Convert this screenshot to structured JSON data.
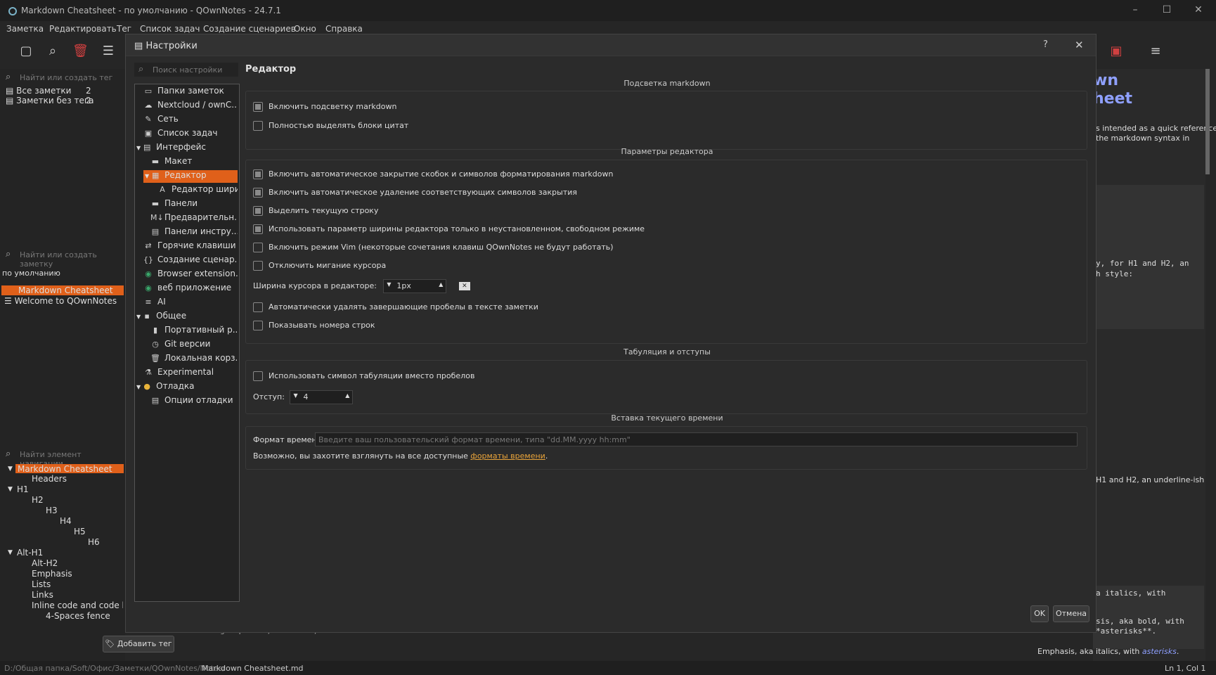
{
  "window": {
    "title": "Markdown Cheatsheet - по умолчанию - QOwnNotes - 24.7.1"
  },
  "menu": [
    "Заметка",
    "Редактировать",
    "Тег",
    "Список задач",
    "Создание сценариев",
    "Окно",
    "Справка"
  ],
  "left": {
    "tag_search": "Найти или создать тег",
    "tags": [
      {
        "label": "Все заметки",
        "count": "2"
      },
      {
        "label": "Заметки без тега",
        "count": "2"
      }
    ],
    "note_search": "Найти или создать заметку",
    "folder": "по умолчанию",
    "notes": [
      "Markdown Cheatsheet",
      "Welcome to QOwnNotes"
    ],
    "nav_search": "Найти элемент навигации",
    "nav": [
      "Markdown Cheatsheet",
      "Headers",
      "H1",
      "H2",
      "H3",
      "H4",
      "H5",
      "H6",
      "Alt-H1",
      "Alt-H2",
      "Emphasis",
      "Lists",
      "Links",
      "Inline code and code bloc",
      "4-Spaces fence"
    ],
    "add_tag": "Добавить тег"
  },
  "right": {
    "heading1": "wn",
    "heading2": "heet",
    "desc1": "s intended as a quick reference",
    "desc2": " the markdown syntax in",
    "code1": "y, for H1 and H2, an",
    "code2": "h style:",
    "h1h2": "H1 and H2, an underline-ish",
    "code3": "a italics, with",
    "code4": "sis, aka bold, with",
    "code5": "*asterisks**.",
    "emph": "Emphasis, aka italics, with ",
    "emph_link": "asterisks",
    "emph_end": ".",
    "bottom_code": "Strong emphasis, aka bold, with  asterisks  ."
  },
  "status": {
    "path_dim": "D:/Общая папка/Soft/Офис/Заметки/QOwnNotes/Notes/",
    "file": "Markdown Cheatsheet.md",
    "cursor": "Ln 1, Col 1"
  },
  "dialog": {
    "title": "Настройки",
    "help": "?",
    "search_placeholder": "Поиск настройки",
    "tree": [
      "Папки заметок",
      "Nextcloud / ownC...",
      "Сеть",
      "Список задач",
      "Интерфейс",
      "Макет",
      "Редактор",
      "Редактор шири...",
      "Панели",
      "Предварительн...",
      "Панели инстру...",
      "Горячие клавиши",
      "Создание сценар...",
      "Browser extension...",
      "веб приложение",
      "AI",
      "Общее",
      "Портативный р...",
      "Git версии",
      "Локальная корз...",
      "Experimental",
      "Отладка",
      "Опции отладки"
    ],
    "page_title": "Редактор",
    "sec_highlight": "Подсветка markdown",
    "cb_highlight": "Включить подсветку markdown",
    "cb_quotes": "Полностью выделять блоки цитат",
    "sec_editor": "Параметры редактора",
    "cb_autoclose": "Включить автоматическое закрытие скобок и символов форматирования markdown",
    "cb_autoremove": "Включить автоматическое удаление соответствующих символов закрытия",
    "cb_curline": "Выделить текущую строку",
    "cb_width": "Использовать параметр ширины редактора только в неустановленном, свободном режиме",
    "cb_vim": "Включить режим Vim (некоторые сочетания клавиш QOwnNotes не будут работать)",
    "cb_blink": "Отключить мигание курсора",
    "cursor_width_label": "Ширина курсора в редакторе:",
    "cursor_width_value": "1px",
    "cb_trailing": "Автоматически удалять завершающие пробелы в тексте заметки",
    "cb_linenums": "Показывать номера строк",
    "sec_tabs": "Табуляция и отступы",
    "cb_tabchar": "Использовать символ табуляции вместо пробелов",
    "indent_label": "Отступ:",
    "indent_value": "4",
    "sec_time": "Вставка текущего времени",
    "time_label": "Формат времени:",
    "time_placeholder": "Введите ваш пользовательский формат времени, типа \"dd.MM.yyyy hh:mm\"",
    "time_hint": "Возможно, вы захотите взглянуть на все доступные ",
    "time_link": "форматы времени",
    "time_hint_end": ".",
    "ok": "OK",
    "cancel": "Отмена"
  },
  "colors": {
    "accent": "#e0601a",
    "link": "#e8a33a"
  }
}
